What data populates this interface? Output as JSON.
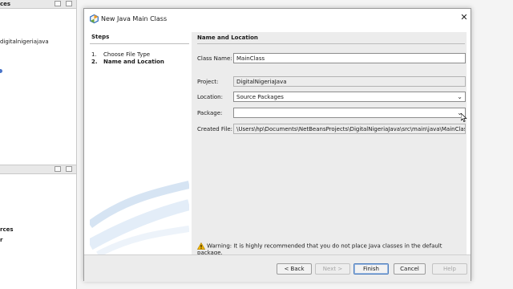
{
  "ide": {
    "projects_header": "ces",
    "project_item": "digitalnigeriajava",
    "nav_item_1": "rces",
    "nav_item_2": "r"
  },
  "dialog": {
    "title": "New Java Main Class",
    "steps": {
      "heading": "Steps",
      "items": [
        {
          "number": "1.",
          "label": "Choose File Type"
        },
        {
          "number": "2.",
          "label": "Name and Location"
        }
      ]
    },
    "section_title": "Name and Location",
    "class_name": {
      "label": "Class Name:",
      "value": "MainClass"
    },
    "project": {
      "label": "Project:",
      "value": "DigitalNigeriaJava"
    },
    "location": {
      "label": "Location:",
      "value": "Source Packages"
    },
    "package": {
      "label": "Package:",
      "value": ""
    },
    "created_file": {
      "label": "Created File:",
      "value": "\\Users\\hp\\Documents\\NetBeansProjects\\DigitalNigeriaJava\\src\\main\\java\\MainClass.java"
    },
    "warning": "Warning: It is highly recommended that you do not place Java classes in the default package.",
    "buttons": {
      "back": "< Back",
      "next": "Next >",
      "finish": "Finish",
      "cancel": "Cancel",
      "help": "Help"
    }
  },
  "colors": {
    "default_button_border": "#4d7dbd",
    "warning_icon": "#f2b705"
  }
}
